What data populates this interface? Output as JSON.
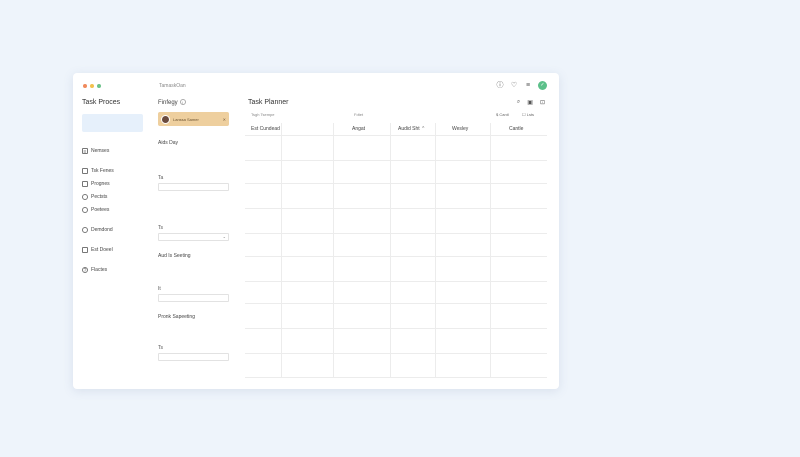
{
  "window": {
    "title": "TamaskOan",
    "dot_colors": [
      "#f08a5d",
      "#f2c14e",
      "#6cc28a"
    ],
    "icons": [
      "help-icon",
      "heart-icon",
      "menu-icon",
      "status-icon"
    ],
    "status_badge": "✓"
  },
  "sidebar": {
    "title": "Task Proces",
    "items": [
      {
        "label": "Nemses",
        "icon": "list-icon"
      },
      {
        "label": "Tsk Fenes",
        "icon": "checkbox-icon"
      },
      {
        "label": "Prognes",
        "icon": "checkbox-icon"
      },
      {
        "label": "Pectsts",
        "icon": "circle-icon"
      },
      {
        "label": "Poetees",
        "icon": "circle-icon"
      },
      {
        "label": "Demdond",
        "icon": "circle-icon"
      },
      {
        "label": "Est Doeel",
        "icon": "checkbox-icon"
      },
      {
        "label": "Flactes",
        "icon": "help-circle-icon"
      }
    ]
  },
  "settings": {
    "heading": "Finfegy",
    "user_card": {
      "name": "Lanssa Samer",
      "bg": "#eecf9e"
    },
    "section1": "Aids Day",
    "field1_label": "Ta",
    "field2_label": "Ts",
    "section2": "Aud Is Seeting",
    "field3_label": "It",
    "section3": "Pronk Sapeeting",
    "field4_label": "Ts"
  },
  "planner": {
    "title": "Task Planner",
    "col_labels": [
      "Tsgh Tsempe",
      "Fdtet"
    ],
    "buttons": [
      {
        "label": "Cantl",
        "icon": "dollar-icon"
      },
      {
        "label": "Lsts",
        "icon": "edit-icon"
      }
    ],
    "columns": [
      "Est Cundead",
      "Angat",
      "Audid Sht ⌃",
      "Wesley",
      "Cantle"
    ]
  }
}
